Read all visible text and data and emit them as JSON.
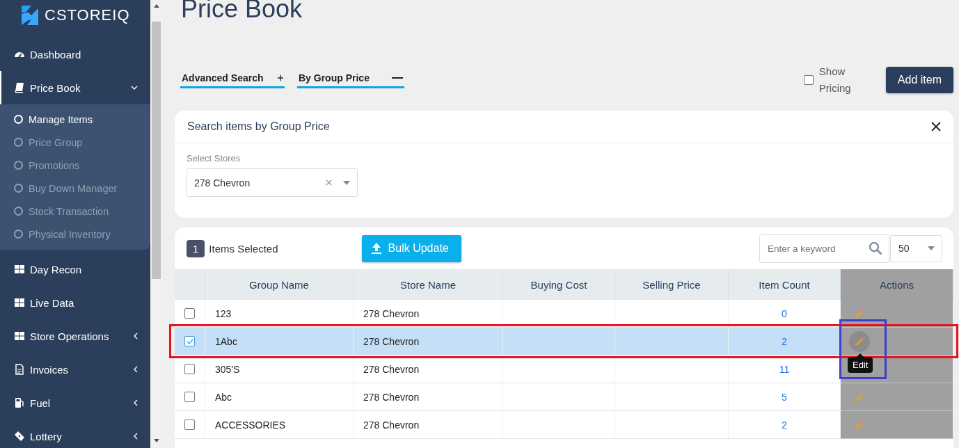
{
  "sidebar": {
    "logo": "CSTOREIQ",
    "items": [
      {
        "label": "Dashboard",
        "selected": false
      },
      {
        "label": "Price Book",
        "selected": true,
        "expanded": true,
        "children": [
          {
            "label": "Manage Items",
            "selected": true
          },
          {
            "label": "Price Group",
            "selected": false
          },
          {
            "label": "Promotions",
            "selected": false
          },
          {
            "label": "Buy Down Manager",
            "selected": false
          },
          {
            "label": "Stock Transaction",
            "selected": false
          },
          {
            "label": "Physical Inventory",
            "selected": false
          }
        ]
      },
      {
        "label": "Day Recon",
        "selected": false
      },
      {
        "label": "Live Data",
        "selected": false
      },
      {
        "label": "Store Operations",
        "selected": false,
        "expanded": false
      },
      {
        "label": "Invoices",
        "selected": false,
        "expanded": false
      },
      {
        "label": "Fuel",
        "selected": false,
        "expanded": false
      },
      {
        "label": "Lottery",
        "selected": false,
        "expanded": false
      }
    ]
  },
  "page": {
    "title": "Price Book"
  },
  "filter_tabs": [
    {
      "label": "Advanced Search",
      "expanded": false
    },
    {
      "label": "By Group Price",
      "expanded": true
    }
  ],
  "show_pricing": {
    "label": "Show Pricing",
    "checked": false
  },
  "add_item": "Add item",
  "search_panel": {
    "title": "Search items by Group Price",
    "field_label": "Select Stores",
    "store": "278 Chevron"
  },
  "table": {
    "selected_count": "1",
    "selected_label": "Items Selected",
    "bulk_update": "Bulk Update",
    "search_placeholder": "Enter a keyword",
    "page_size": "50",
    "columns": [
      "Group Name",
      "Store Name",
      "Buying Cost",
      "Selling Price",
      "Item Count",
      "Actions"
    ],
    "rows": [
      {
        "group": "123",
        "store": "278 Chevron",
        "item_count": "0",
        "selected": false,
        "highlighted": false
      },
      {
        "group": "1Abc",
        "store": "278 Chevron",
        "item_count": "2",
        "selected": true,
        "highlighted": true,
        "tooltip": "Edit"
      },
      {
        "group": "305'S",
        "store": "278 Chevron",
        "item_count": "11",
        "selected": false,
        "highlighted": false
      },
      {
        "group": "Abc",
        "store": "278 Chevron",
        "item_count": "5",
        "selected": false,
        "highlighted": false
      },
      {
        "group": "ACCESSORIES",
        "store": "278 Chevron",
        "item_count": "2",
        "selected": false,
        "highlighted": false
      }
    ]
  }
}
